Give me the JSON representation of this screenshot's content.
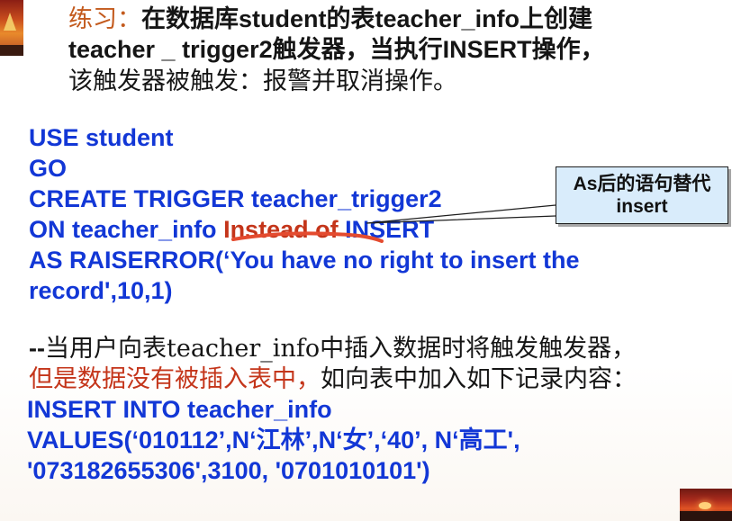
{
  "exercise": {
    "prefix": "练习：",
    "line1_suffix": "在数据库student的表teacher_info上创建",
    "line2": "teacher _ trigger2触发器，当执行INSERT操作，",
    "line3": "该触发器被触发：报警并取消操作。"
  },
  "code": {
    "line1": "USE student",
    "line2": "GO",
    "line3": "CREATE TRIGGER teacher_trigger2",
    "line4_prefix": "ON teacher_info ",
    "line4_highlight": "Instead of ",
    "line4_suffix": "INSERT",
    "line5": "AS    RAISERROR(‘You have no right to insert the",
    "line6": "record',10,1)"
  },
  "callout": {
    "line1": "As后的语句替代",
    "line2": "insert"
  },
  "notes": {
    "line1_prefix": "--",
    "line1_text": "当用户向表teacher_info中插入数据时将触发触发器，",
    "line2_red": "但是数据没有被插入表中，",
    "line2_black": "如向表中加入如下记录内容："
  },
  "insert_sql": {
    "line1": "INSERT INTO teacher_info",
    "line2": "VALUES(‘010112’,N‘江林’,N‘女’,‘40’, N‘高工',",
    "line3": "'073182655306',3100, '0701010101')"
  },
  "colors": {
    "blue": "#1237d6",
    "orange": "#c35a1d",
    "red": "#c4351a",
    "black": "#151515",
    "callout_bg": "#d9ecfb"
  }
}
